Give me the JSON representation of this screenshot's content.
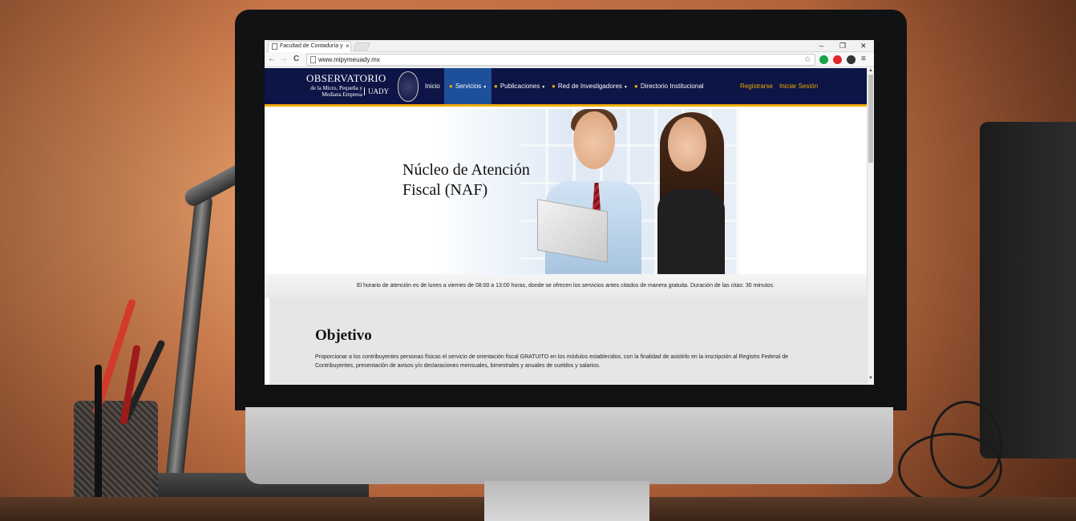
{
  "browser": {
    "tab_title": "Facultad de Contaduría y",
    "tab_close": "×",
    "window_controls": {
      "minimize": "–",
      "restore": "❐",
      "close": "✕"
    },
    "nav": {
      "back": "←",
      "forward": "→",
      "reload": "C"
    },
    "url": "www.mipymeuady.mx",
    "bookmark_icon": "☆",
    "extensions": [
      {
        "name": "green-extension-icon",
        "color": "#1aa34a"
      },
      {
        "name": "opera-extension-icon",
        "color": "#e0262c"
      },
      {
        "name": "dark-extension-icon",
        "color": "#333333"
      }
    ],
    "menu_icon": "≡"
  },
  "site": {
    "logo": {
      "title": "OBSERVATORIO",
      "subtitle": "de la Micro, Pequeña y Mediana Empresa",
      "institution": "UADY"
    },
    "nav_items": [
      {
        "label": "Inicio",
        "active": false
      },
      {
        "label": "Servicios",
        "active": true
      },
      {
        "label": "Publicaciones",
        "active": false
      },
      {
        "label": "Red de Investigadores",
        "active": false
      },
      {
        "label": "Directorio Institucional",
        "active": false
      }
    ],
    "auth": {
      "register": "Registrarse",
      "login": "Iniciar Sesión"
    },
    "accent_color": "#f0ab00",
    "header_color": "#0d1446"
  },
  "hero": {
    "title_line1": "Núcleo de Atención",
    "title_line2": "Fiscal (NAF)"
  },
  "info": {
    "text": "El horario de atención es de lunes a viernes de 08:00 a 13:00 horas, donde se ofrecen los servicios antes citados de manera gratuita. Duración de las citas: 30 minutos."
  },
  "objective": {
    "title": "Objetivo",
    "body": "Proporcionar a los contribuyentes personas físicas el servicio de orientación fiscal GRATUITO en los módulos establecidos, con la finalidad de asistirlo en la inscripción al Registro Federal de Contribuyentes, presentación de avisos y/o declaraciones mensuales, bimestrales y anuales de sueldos y salarios."
  },
  "scrollbar": {
    "up": "▲",
    "down": "▼"
  },
  "device": {
    "logo": ""
  }
}
